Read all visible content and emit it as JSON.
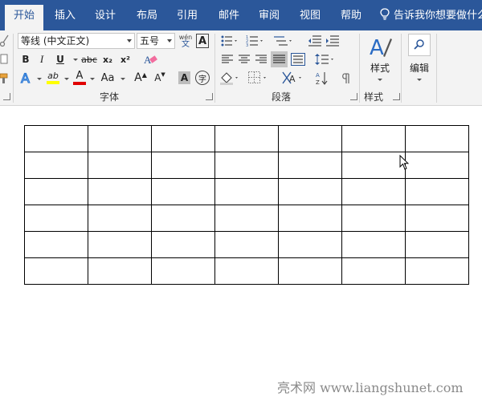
{
  "tabs": [
    {
      "label": "开始",
      "active": true
    },
    {
      "label": "插入"
    },
    {
      "label": "设计"
    },
    {
      "label": "布局"
    },
    {
      "label": "引用"
    },
    {
      "label": "邮件"
    },
    {
      "label": "审阅"
    },
    {
      "label": "视图"
    },
    {
      "label": "帮助"
    }
  ],
  "tell_me": "告诉我你想要做什么",
  "font": {
    "name": "等线 (中文正文)",
    "size": "五号",
    "phonetic_top": "wén",
    "phonetic_bottom": "文",
    "border_char": "A",
    "bold": "B",
    "italic": "I",
    "underline": "U",
    "strike": "abc",
    "subscript": "x₂",
    "superscript": "x²",
    "text_effect": "A",
    "highlight": "ab",
    "font_color": "A",
    "change_case": "Aa",
    "grow": "A",
    "shrink": "A",
    "char_shading": "A",
    "enclose": "字",
    "group_label": "字体"
  },
  "paragraph": {
    "group_label": "段落"
  },
  "styles": {
    "label": "样式",
    "group_label": "样式"
  },
  "editing": {
    "label": "编辑"
  },
  "table": {
    "rows": 6,
    "cols": 7
  },
  "watermark": "亮术网 www.liangshunet.com",
  "colors": {
    "ribbon_blue": "#2b579a",
    "ribbon_bg": "#f3f3f3",
    "highlight_yellow": "#ffff00",
    "font_red": "#e00000"
  }
}
